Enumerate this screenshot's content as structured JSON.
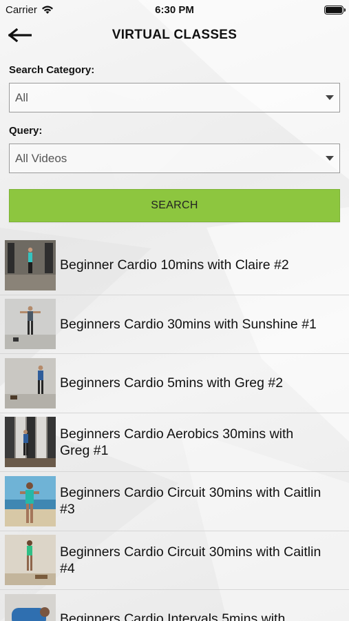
{
  "status": {
    "carrier": "Carrier",
    "time": "6:30 PM"
  },
  "nav": {
    "title": "VIRTUAL CLASSES"
  },
  "form": {
    "category_label": "Search Category:",
    "category_value": "All",
    "query_label": "Query:",
    "query_value": "All Videos",
    "search_label": "SEARCH"
  },
  "videos": [
    {
      "title": "Beginner Cardio 10mins with Claire #2"
    },
    {
      "title": "Beginners Cardio 30mins with Sunshine #1"
    },
    {
      "title": "Beginners Cardio 5mins with Greg #2"
    },
    {
      "title": "Beginners Cardio Aerobics 30mins with Greg #1"
    },
    {
      "title": "Beginners Cardio Circuit 30mins with Caitlin #3"
    },
    {
      "title": "Beginners Cardio Circuit 30mins with Caitlin #4"
    },
    {
      "title": "Beginners Cardio Intervals 5mins with"
    }
  ],
  "colors": {
    "accent": "#8dc63f"
  }
}
